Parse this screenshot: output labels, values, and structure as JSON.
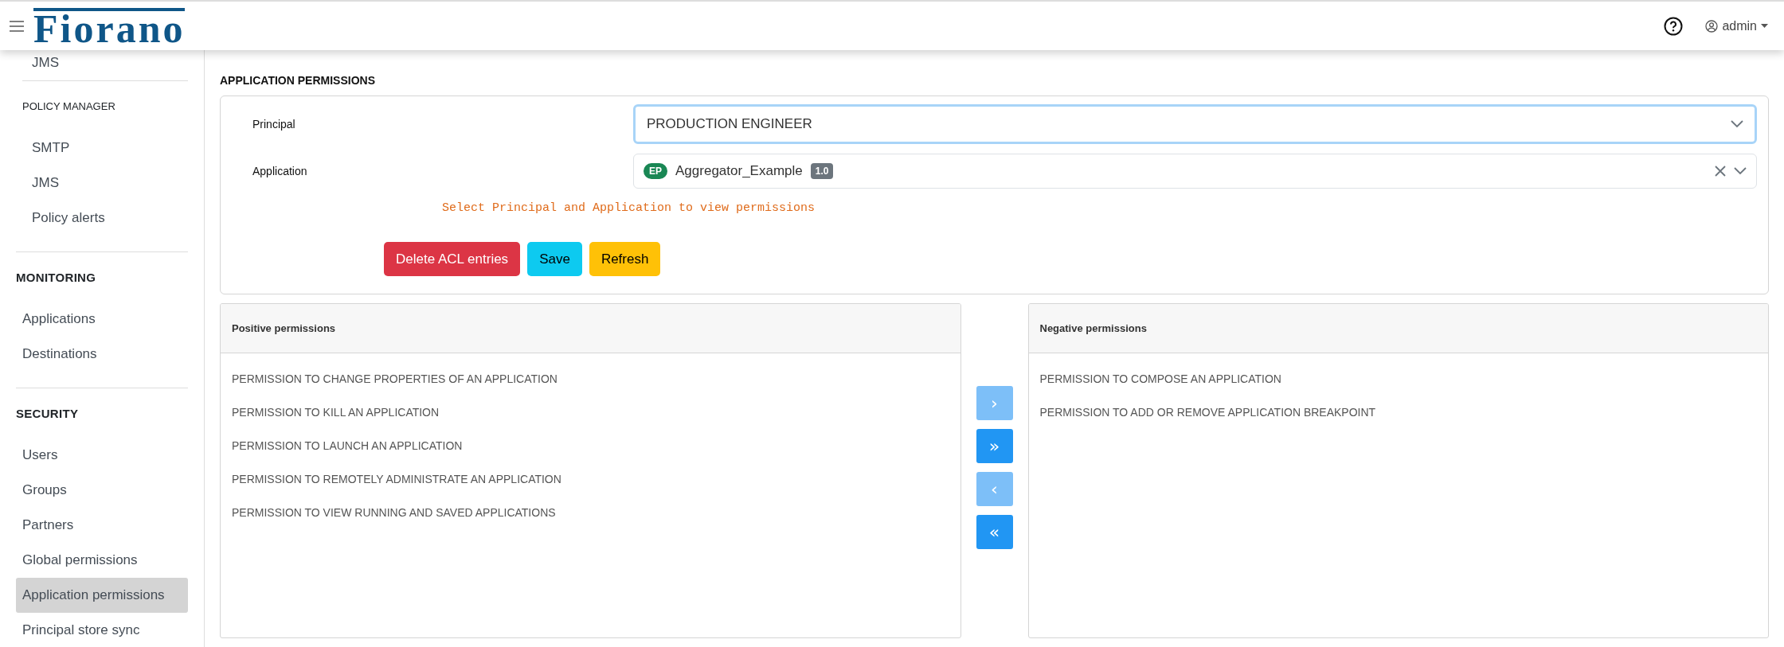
{
  "header": {
    "logo": "Fiorano",
    "user": "admin"
  },
  "sidebar": {
    "sections": [
      {
        "kind": "sub",
        "items": [
          {
            "label": "JMS",
            "selected": false
          }
        ]
      },
      {
        "kind": "sub",
        "title": "POLICY MANAGER",
        "items": [
          {
            "label": "SMTP",
            "selected": false
          },
          {
            "label": "JMS",
            "selected": false
          },
          {
            "label": "Policy alerts",
            "selected": false
          }
        ]
      },
      {
        "kind": "main",
        "title": "MONITORING",
        "items": [
          {
            "label": "Applications",
            "selected": false
          },
          {
            "label": "Destinations",
            "selected": false
          }
        ]
      },
      {
        "kind": "main",
        "title": "SECURITY",
        "items": [
          {
            "label": "Users",
            "selected": false
          },
          {
            "label": "Groups",
            "selected": false
          },
          {
            "label": "Partners",
            "selected": false
          },
          {
            "label": "Global permissions",
            "selected": false
          },
          {
            "label": "Application permissions",
            "selected": true
          },
          {
            "label": "Principal store sync",
            "selected": false
          }
        ]
      }
    ]
  },
  "page_title": "APPLICATION PERMISSIONS",
  "form": {
    "principal": {
      "label": "Principal",
      "value": "PRODUCTION ENGINEER",
      "focused": true
    },
    "application": {
      "label": "Application",
      "tag": "EP",
      "value": "Aggregator_Example",
      "version": "1.0",
      "focused": false
    },
    "message": "Select Principal and Application to view permissions",
    "buttons": [
      {
        "label": "Delete ACL entries",
        "kind": "danger"
      },
      {
        "label": "Save",
        "kind": "info"
      },
      {
        "label": "Refresh",
        "kind": "warning"
      }
    ]
  },
  "positive_permissions": {
    "title": "Positive permissions",
    "items": [
      {
        "label": "PERMISSION TO CHANGE PROPERTIES OF AN APPLICATION",
        "selected": false
      },
      {
        "label": "PERMISSION TO KILL AN APPLICATION",
        "selected": false
      },
      {
        "label": "PERMISSION TO LAUNCH AN APPLICATION",
        "selected": false
      },
      {
        "label": "PERMISSION TO REMOTELY ADMINISTRATE AN APPLICATION",
        "selected": false
      },
      {
        "label": "PERMISSION TO VIEW RUNNING AND SAVED APPLICATIONS",
        "selected": false
      }
    ]
  },
  "transfer_buttons": [
    {
      "label": "›",
      "disabled": true
    },
    {
      "label": "»",
      "disabled": false
    },
    {
      "label": "‹",
      "disabled": true
    },
    {
      "label": "«",
      "disabled": false
    }
  ],
  "negative_permissions": {
    "title": "Negative permissions",
    "items": [
      {
        "label": "PERMISSION TO COMPOSE AN APPLICATION",
        "selected": false
      },
      {
        "label": "PERMISSION TO ADD OR REMOVE APPLICATION BREAKPOINT",
        "selected": false
      }
    ]
  }
}
